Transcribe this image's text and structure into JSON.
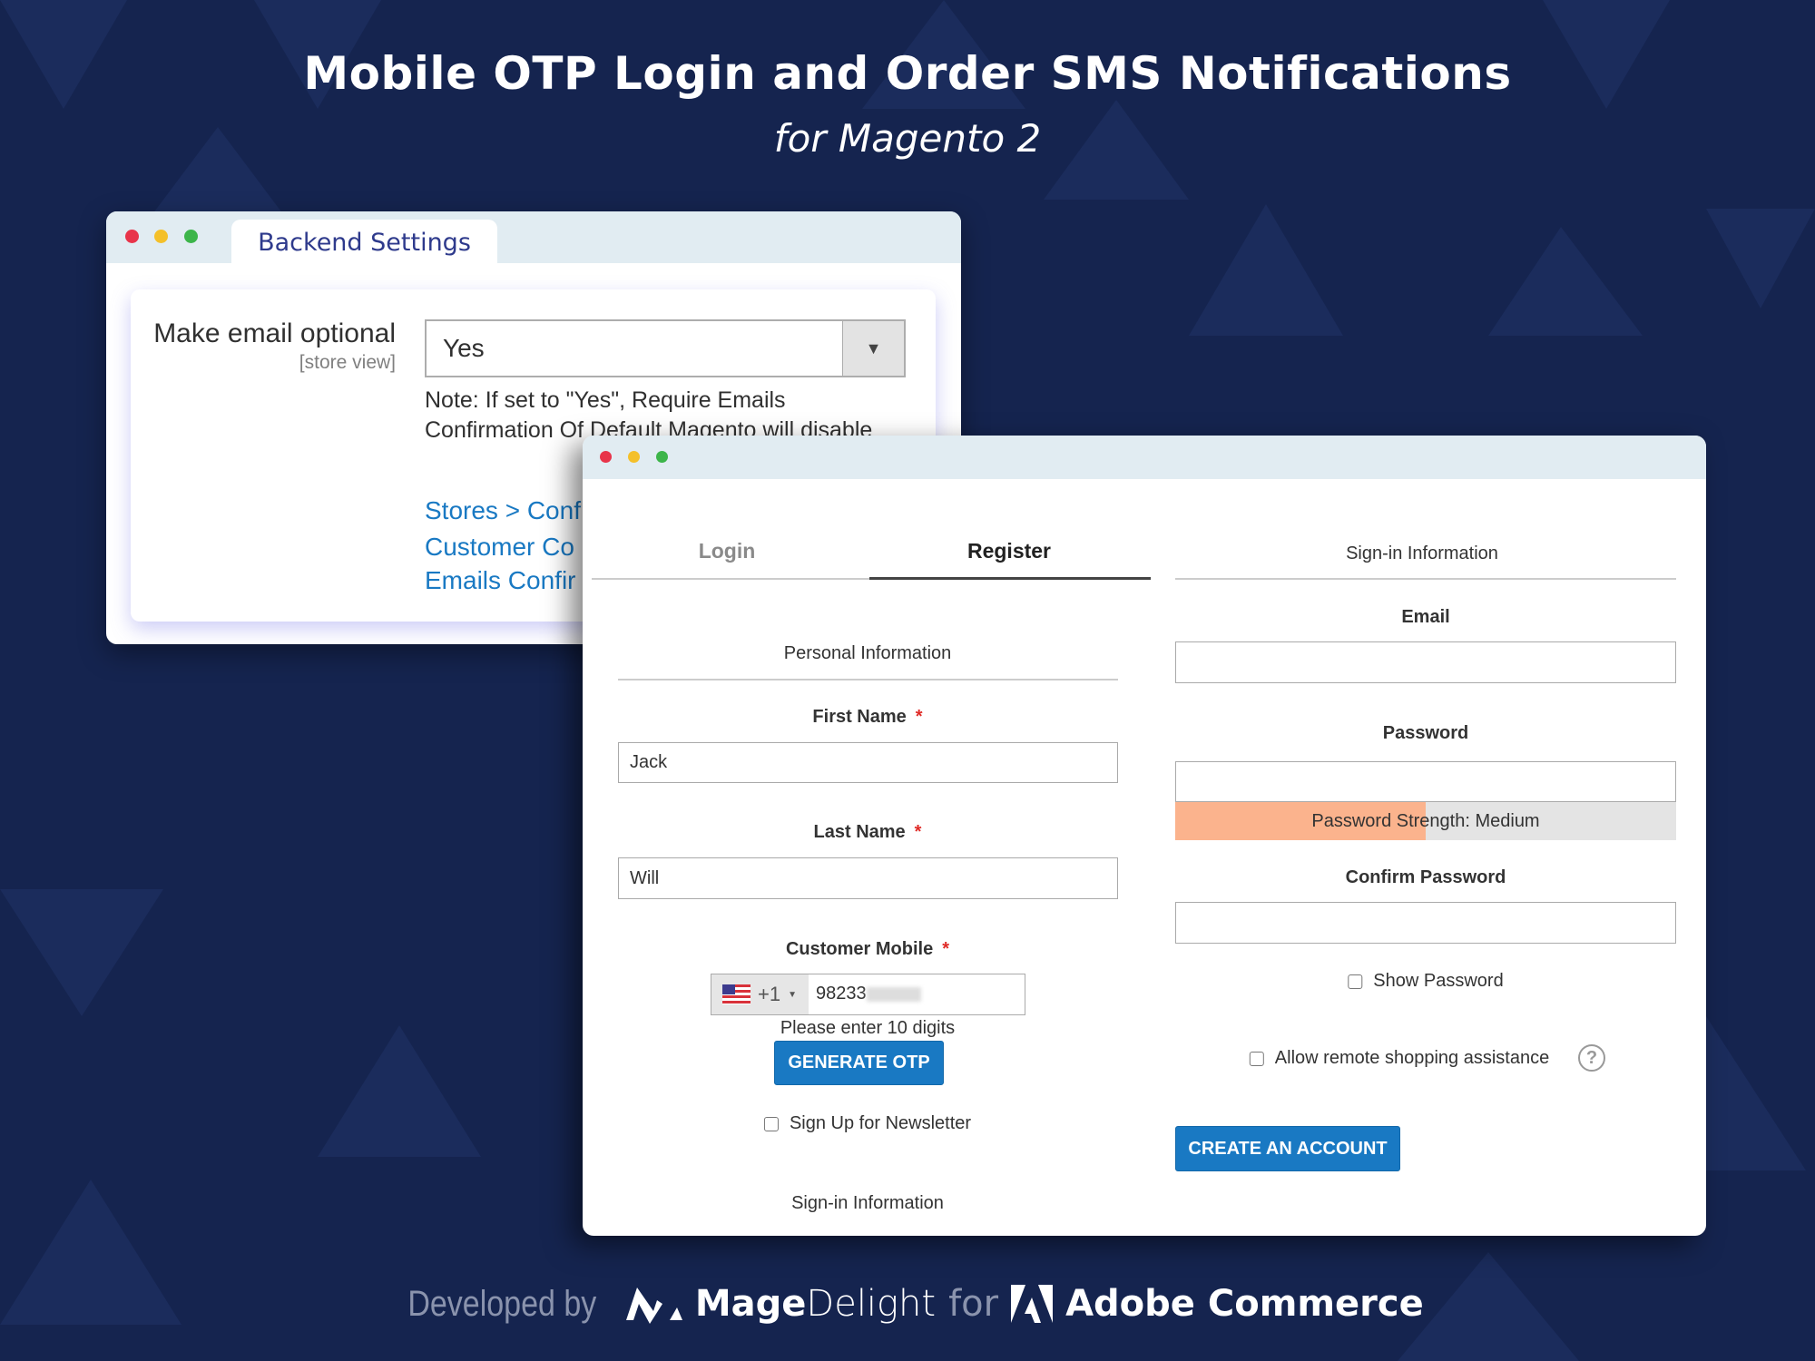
{
  "header": {
    "title": "Mobile OTP Login and Order SMS Notifications",
    "subtitle": "for Magento 2"
  },
  "colors": {
    "background": "#15244f",
    "accent": "#1979c3",
    "tab_title": "#2e3a8c",
    "strength_medium": "#fbb38d",
    "window_dots": [
      "#e8344a",
      "#f4c02a",
      "#3cb54a"
    ]
  },
  "backend": {
    "tab": "Backend Settings",
    "field_label": "Make email optional",
    "scope": "[store view]",
    "select_value": "Yes",
    "note_line1": "Note: If set to \"Yes\", Require Emails",
    "note_line2": "Confirmation Of Default Magento will disable",
    "links": [
      "Stores > Conf",
      "Customer Co",
      "Emails Confir"
    ]
  },
  "register": {
    "tabs": {
      "login": "Login",
      "register": "Register"
    },
    "personal_heading": "Personal Information",
    "first_name": {
      "label": "First Name",
      "value": "Jack"
    },
    "last_name": {
      "label": "Last Name",
      "value": "Will"
    },
    "required_mark": "*",
    "mobile": {
      "label": "Customer Mobile",
      "country_code": "+1",
      "country_flag": "us-flag-icon",
      "value": "98233",
      "hint": "Please enter 10 digits"
    },
    "generate_otp": "GENERATE OTP",
    "newsletter": "Sign Up for Newsletter",
    "signin_heading_bottom": "Sign-in Information",
    "signin_heading": "Sign-in Information",
    "email": {
      "label": "Email",
      "value": ""
    },
    "password": {
      "label": "Password",
      "value": "",
      "strength_text": "Password Strength: Medium",
      "strength_level": 0.5
    },
    "confirm_password": {
      "label": "Confirm Password",
      "value": ""
    },
    "show_password": "Show Password",
    "remote_assistance": "Allow remote shopping assistance",
    "create_account": "CREATE AN ACCOUNT"
  },
  "footer": {
    "developed_by": "Developed by",
    "brand_bold": "Mage",
    "brand_light": "Delight",
    "for": "for",
    "platform": "Adobe Commerce"
  }
}
